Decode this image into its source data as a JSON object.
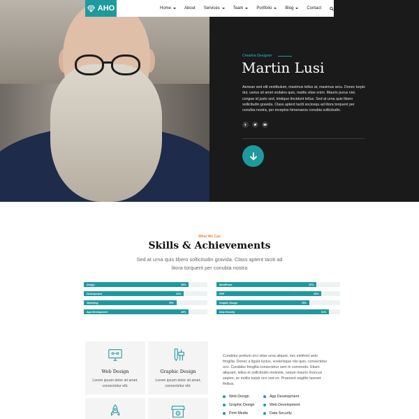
{
  "brand": {
    "name": "AHO",
    "accent": "#1e9a9e"
  },
  "nav": {
    "items": [
      {
        "label": "Home",
        "dropdown": true
      },
      {
        "label": "About",
        "dropdown": false
      },
      {
        "label": "Services",
        "dropdown": true
      },
      {
        "label": "Team",
        "dropdown": true
      },
      {
        "label": "Portfolio",
        "dropdown": true
      },
      {
        "label": "Blog",
        "dropdown": true
      },
      {
        "label": "Contact",
        "dropdown": false
      }
    ],
    "search_icon": "search-icon"
  },
  "hero": {
    "tag": "Creative Designer",
    "name": "Martin Lusi",
    "bio": "Aenean sed elit vestibulum, maximus tellus at, maximus arcu. Donec turpis dui, varius sit amet sodales quis, mattis vitae enim. Mauris purus nisl, congue id justo sed, tristique tincidunt tellus. Sed at urna quis libero sollicitudin gravida. Class aptent taciti sociosqu ad litora torquent per conubia nostra, per inceptos himenaeos conubia sollicitudin.",
    "socials": [
      "facebook-icon",
      "twitter-icon",
      "youtube-icon"
    ]
  },
  "skills": {
    "kicker": "What We Can",
    "title": "Skills & Achievements",
    "subtitle": "Sed at urna quis libero sollicitudin gravida. Class aptent taciti ad litora torquent per conubia nostra",
    "left": [
      {
        "label": "Design",
        "value": "85%"
      },
      {
        "label": "Development",
        "value": "81%"
      },
      {
        "label": "Marketing",
        "value": "75%"
      },
      {
        "label": "App Development",
        "value": "85%"
      }
    ],
    "right": [
      {
        "label": "WordPress",
        "value": "81%"
      },
      {
        "label": "PHP",
        "value": "85%"
      },
      {
        "label": "Graphic Design",
        "value": "75%"
      },
      {
        "label": "Data Security",
        "value": "91%"
      }
    ]
  },
  "services": {
    "cards": [
      {
        "title": "Web Design",
        "desc": "Lorem ipsum dolor sit amet, consectetur elit.",
        "icon": "monitor-icon"
      },
      {
        "title": "Graphic Design",
        "desc": "Lorem ipsum dolor sit amet, consectetur elit.",
        "icon": "pen-tools-icon"
      },
      {
        "title": "",
        "desc": "",
        "icon": "rocket-icon"
      },
      {
        "title": "",
        "desc": "",
        "icon": "shop-icon"
      }
    ],
    "about": "Curabitur pretium orci vitae urna aliquet, nec eleifend ante fringilla. Donec a ligula luctus, scelerisque nisi quis, consectetur orci. Curabitur fringilla consectetur sem in commodo. Etiam aliquam, tellus et sollicitudin molestie, neque mauris rhoncus sapien, ac mollis turpis orci sed ex. Praesent sagittis laoreet finibus.",
    "features": [
      "Web Design",
      "App Development",
      "Graphic Design",
      "Web Development",
      "Print Media",
      "Data Security"
    ]
  }
}
